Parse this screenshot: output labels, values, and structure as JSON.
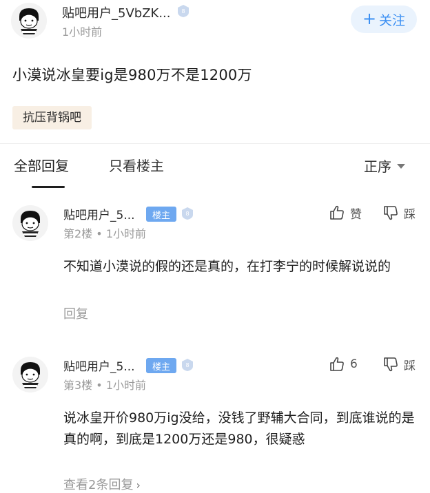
{
  "post": {
    "author": "贴吧用户_5VbZK...",
    "time": "1小时前",
    "follow_label": "关注",
    "follow_icon": "plus-icon",
    "content": "小漠说冰皇要ig是980万不是1200万",
    "tag": "抗压背锅吧"
  },
  "tabs": {
    "all": "全部回复",
    "op_only": "只看楼主",
    "sort": "正序"
  },
  "replies": [
    {
      "author": "贴吧用户_5...",
      "owner_badge": "楼主",
      "floor": "第2楼",
      "dot": "•",
      "time": "1小时前",
      "like_label": "赞",
      "dislike_label": "踩",
      "content": "不知道小漠说的假的还是真的，在打李宁的时候解说说的",
      "reply_link": "回复"
    },
    {
      "author": "贴吧用户_5...",
      "owner_badge": "楼主",
      "floor": "第3楼",
      "dot": "•",
      "time": "1小时前",
      "like_label": "6",
      "dislike_label": "踩",
      "content": "说冰皇开价980万ig没给，没钱了野辅大合同，到底谁说的是真的啊，到底是1200万还是980，很疑惑",
      "reply_link": "查看2条回复"
    }
  ],
  "colors": {
    "accent": "#3b8ff3",
    "follow_bg": "#eaf3fd",
    "owner_badge": "#6ea8f0",
    "tag_bg": "#f8efe4",
    "muted": "#9a9a9a"
  }
}
